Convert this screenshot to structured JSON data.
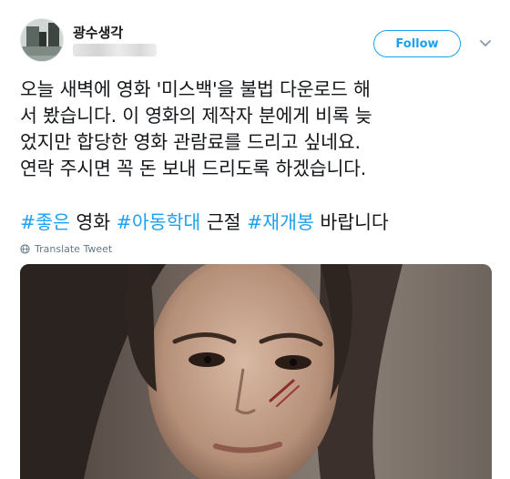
{
  "user": {
    "display_name": "광수생각",
    "avatar_icon": "profile-photo-avatar",
    "handle_blurred": true
  },
  "actions": {
    "follow_label": "Follow",
    "more_icon": "chevron-down-icon"
  },
  "tweet": {
    "lines": [
      "오늘 새벽에 영화 '미스백'을 불법 다운로드 해",
      "서 봤습니다. 이 영화의 제작자 분에게 비록 늦",
      "었지만 합당한 영화 관람료를 드리고 싶네요.",
      "연락 주시면 꼭 돈 보내 드리도록 하겠습니다."
    ],
    "tag_line": [
      {
        "text": "#좋은",
        "kind": "hashtag"
      },
      {
        "text": " 영화 ",
        "kind": "plain"
      },
      {
        "text": "#아동학대",
        "kind": "hashtag"
      },
      {
        "text": " 근절 ",
        "kind": "plain"
      },
      {
        "text": "#재개봉",
        "kind": "hashtag"
      },
      {
        "text": " 바랍니다",
        "kind": "plain"
      }
    ],
    "translate_label": "Translate Tweet",
    "translate_icon": "globe-icon"
  },
  "media": {
    "description_icon": "movie-poster-photo"
  },
  "colors": {
    "accent": "#1da1f2",
    "text": "#14171a",
    "secondary": "#657786"
  }
}
